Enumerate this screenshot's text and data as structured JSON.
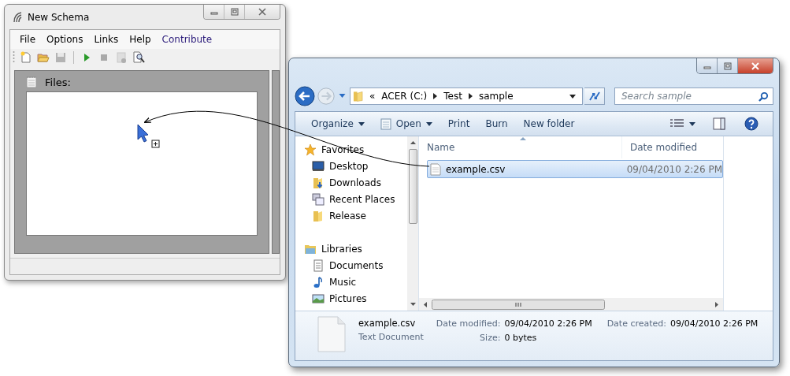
{
  "schema_window": {
    "title": "New Schema",
    "menu": [
      {
        "label": "File",
        "kind": "plain"
      },
      {
        "label": "Options",
        "kind": "plain"
      },
      {
        "label": "Links",
        "kind": "plain"
      },
      {
        "label": "Help",
        "kind": "plain"
      },
      {
        "label": "Contribute",
        "kind": "link"
      }
    ],
    "toolbar": [
      {
        "kind": "new",
        "disabled": false
      },
      {
        "kind": "open",
        "disabled": false
      },
      {
        "kind": "save",
        "disabled": true
      },
      {
        "kind": "separator"
      },
      {
        "kind": "run",
        "disabled": false
      },
      {
        "kind": "stop",
        "disabled": true
      },
      {
        "kind": "clear",
        "disabled": true
      },
      {
        "kind": "inspect",
        "disabled": false
      }
    ],
    "files_panel": {
      "label": "Files:"
    }
  },
  "explorer_window": {
    "breadcrumb": [
      "«",
      "ACER (C:)",
      "Test",
      "sample"
    ],
    "search": {
      "placeholder": "Search sample"
    },
    "commands": [
      {
        "label": "Organize",
        "kind": "menu"
      },
      {
        "label": "Open",
        "kind": "icon_menu"
      },
      {
        "label": "Print",
        "kind": "plain"
      },
      {
        "label": "Burn",
        "kind": "plain"
      },
      {
        "label": "New folder",
        "kind": "plain"
      }
    ],
    "sidebar": [
      {
        "label": "Favorites",
        "kind": "favorites",
        "children": [
          {
            "label": "Desktop",
            "kind": "desktop"
          },
          {
            "label": "Downloads",
            "kind": "downloads"
          },
          {
            "label": "Recent Places",
            "kind": "recent"
          },
          {
            "label": "Release",
            "kind": "folder"
          }
        ]
      },
      {
        "label": "Libraries",
        "kind": "libraries",
        "children": [
          {
            "label": "Documents",
            "kind": "documents"
          },
          {
            "label": "Music",
            "kind": "music"
          },
          {
            "label": "Pictures",
            "kind": "pictures"
          }
        ]
      }
    ],
    "columns": [
      "Name",
      "Date modified"
    ],
    "files": [
      {
        "name": "example.csv",
        "date": "09/04/2010 2:26 PM",
        "selected": true
      }
    ],
    "details": {
      "name": "example.csv",
      "type": "Text Document",
      "fields": [
        {
          "label": "Date modified:",
          "value": "09/04/2010 2:26 PM"
        },
        {
          "label": "Date created:",
          "value": "09/04/2010 2:26 PM"
        },
        {
          "label": "Size:",
          "value": "0 bytes"
        }
      ]
    }
  }
}
